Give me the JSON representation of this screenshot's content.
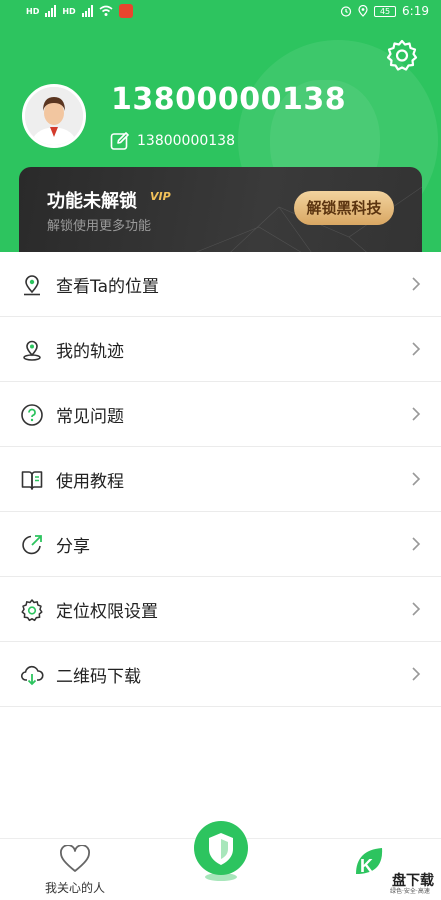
{
  "status_bar": {
    "left_label_1": "HD",
    "left_label_2": "HD",
    "time": "6:19",
    "battery": "45"
  },
  "profile": {
    "phone": "13800000138",
    "nickname": "13800000138"
  },
  "vip": {
    "title": "功能未解锁",
    "tag": "VIP",
    "subtitle": "解锁使用更多功能",
    "unlock_label": "解锁黑科技"
  },
  "menu": [
    {
      "label": "查看Ta的位置",
      "icon": "location-pin-icon"
    },
    {
      "label": "我的轨迹",
      "icon": "track-pin-icon"
    },
    {
      "label": "常见问题",
      "icon": "question-icon"
    },
    {
      "label": "使用教程",
      "icon": "book-icon"
    },
    {
      "label": "分享",
      "icon": "share-icon"
    },
    {
      "label": "定位权限设置",
      "icon": "gear-icon"
    },
    {
      "label": "二维码下载",
      "icon": "cloud-download-icon"
    }
  ],
  "bottom_nav": {
    "care_label": "我关心的人"
  },
  "watermark": {
    "text": "盘下载",
    "sub": "绿色·安全·高速"
  },
  "colors": {
    "brand_green": "#2dc45f",
    "vip_gold": "#d9a763"
  }
}
